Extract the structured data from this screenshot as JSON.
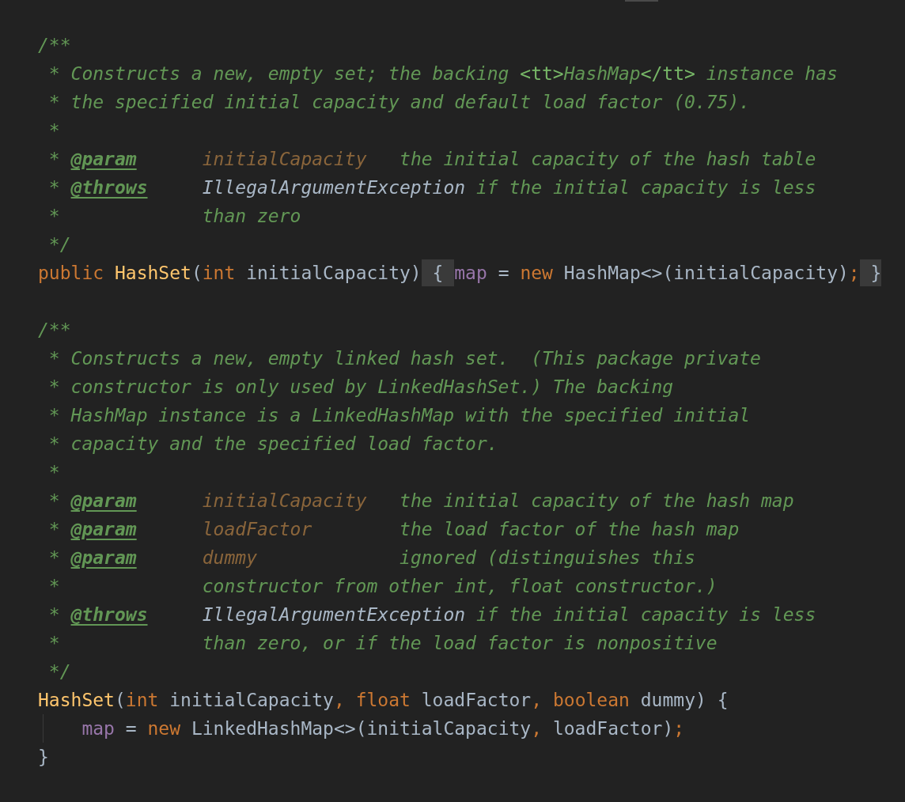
{
  "editor": {
    "lines": [
      {
        "kind": "code",
        "tokens": [
          {
            "kind": "comment",
            "text": "/**"
          }
        ]
      },
      {
        "kind": "code",
        "tokens": [
          {
            "kind": "comment",
            "text": " * Constructs a new, empty set; the backing "
          },
          {
            "kind": "html",
            "text": "<tt>"
          },
          {
            "kind": "comment",
            "text": "HashMap"
          },
          {
            "kind": "html",
            "text": "</tt>"
          },
          {
            "kind": "comment",
            "text": " instance has"
          }
        ]
      },
      {
        "kind": "code",
        "tokens": [
          {
            "kind": "comment",
            "text": " * the specified initial capacity and default load factor (0.75)."
          }
        ]
      },
      {
        "kind": "code",
        "tokens": [
          {
            "kind": "comment",
            "text": " *"
          }
        ]
      },
      {
        "kind": "code",
        "tokens": [
          {
            "kind": "comment",
            "text": " * "
          },
          {
            "kind": "doctag",
            "text": "@param"
          },
          {
            "kind": "param",
            "text": "      initialCapacity"
          },
          {
            "kind": "comment",
            "text": "   the initial capacity of the hash table"
          }
        ]
      },
      {
        "kind": "code",
        "tokens": [
          {
            "kind": "comment",
            "text": " * "
          },
          {
            "kind": "doctag",
            "text": "@throws"
          },
          {
            "kind": "ref",
            "text": "     IllegalArgumentException"
          },
          {
            "kind": "comment",
            "text": " if the initial capacity is less"
          }
        ]
      },
      {
        "kind": "code",
        "tokens": [
          {
            "kind": "comment",
            "text": " *"
          },
          {
            "kind": "comment",
            "text": "             than zero"
          }
        ]
      },
      {
        "kind": "code",
        "tokens": [
          {
            "kind": "comment",
            "text": " */"
          }
        ]
      },
      {
        "kind": "code",
        "tokens": [
          {
            "kind": "keyword",
            "text": "public "
          },
          {
            "kind": "method",
            "text": "HashSet"
          },
          {
            "kind": "ident",
            "text": "("
          },
          {
            "kind": "keyword",
            "text": "int"
          },
          {
            "kind": "ident",
            "text": " initialCapacity)"
          },
          {
            "kind": "fold",
            "text": " { "
          },
          {
            "kind": "field",
            "text": "map"
          },
          {
            "kind": "ident",
            "text": " = "
          },
          {
            "kind": "keyword",
            "text": "new"
          },
          {
            "kind": "ident",
            "text": " HashMap<>(initialCapacity)"
          },
          {
            "kind": "punct",
            "text": ";"
          },
          {
            "kind": "fold",
            "text": " }"
          }
        ]
      },
      {
        "kind": "blank"
      },
      {
        "kind": "code",
        "tokens": [
          {
            "kind": "comment",
            "text": "/**"
          }
        ]
      },
      {
        "kind": "code",
        "tokens": [
          {
            "kind": "comment",
            "text": " * Constructs a new, empty linked hash set.  (This package private"
          }
        ]
      },
      {
        "kind": "code",
        "tokens": [
          {
            "kind": "comment",
            "text": " * constructor is only used by LinkedHashSet.) The backing"
          }
        ]
      },
      {
        "kind": "code",
        "tokens": [
          {
            "kind": "comment",
            "text": " * HashMap instance is a LinkedHashMap with the specified initial"
          }
        ]
      },
      {
        "kind": "code",
        "tokens": [
          {
            "kind": "comment",
            "text": " * capacity and the specified load factor."
          }
        ]
      },
      {
        "kind": "code",
        "tokens": [
          {
            "kind": "comment",
            "text": " *"
          }
        ]
      },
      {
        "kind": "code",
        "tokens": [
          {
            "kind": "comment",
            "text": " * "
          },
          {
            "kind": "doctag",
            "text": "@param"
          },
          {
            "kind": "param",
            "text": "      initialCapacity"
          },
          {
            "kind": "comment",
            "text": "   the initial capacity of the hash map"
          }
        ]
      },
      {
        "kind": "code",
        "tokens": [
          {
            "kind": "comment",
            "text": " * "
          },
          {
            "kind": "doctag",
            "text": "@param"
          },
          {
            "kind": "param",
            "text": "      loadFactor"
          },
          {
            "kind": "comment",
            "text": "        the load factor of the hash map"
          }
        ]
      },
      {
        "kind": "code",
        "tokens": [
          {
            "kind": "comment",
            "text": " * "
          },
          {
            "kind": "doctag",
            "text": "@param"
          },
          {
            "kind": "param",
            "text": "      dummy"
          },
          {
            "kind": "comment",
            "text": "             ignored (distinguishes this"
          }
        ]
      },
      {
        "kind": "code",
        "tokens": [
          {
            "kind": "comment",
            "text": " *"
          },
          {
            "kind": "comment",
            "text": "             constructor from other int, float constructor.)"
          }
        ]
      },
      {
        "kind": "code",
        "tokens": [
          {
            "kind": "comment",
            "text": " * "
          },
          {
            "kind": "doctag",
            "text": "@throws"
          },
          {
            "kind": "ref",
            "text": "     IllegalArgumentException"
          },
          {
            "kind": "comment",
            "text": " if the initial capacity is less"
          }
        ]
      },
      {
        "kind": "code",
        "tokens": [
          {
            "kind": "comment",
            "text": " *"
          },
          {
            "kind": "comment",
            "text": "             than zero, or if the load factor is nonpositive"
          }
        ]
      },
      {
        "kind": "code",
        "tokens": [
          {
            "kind": "comment",
            "text": " */"
          }
        ]
      },
      {
        "kind": "code",
        "tokens": [
          {
            "kind": "method",
            "text": "HashSet"
          },
          {
            "kind": "ident",
            "text": "("
          },
          {
            "kind": "keyword",
            "text": "int"
          },
          {
            "kind": "ident",
            "text": " initialCapacity"
          },
          {
            "kind": "punct",
            "text": ","
          },
          {
            "kind": "keyword",
            "text": " float"
          },
          {
            "kind": "ident",
            "text": " loadFactor"
          },
          {
            "kind": "punct",
            "text": ","
          },
          {
            "kind": "keyword",
            "text": " boolean"
          },
          {
            "kind": "ident",
            "text": " dummy) {"
          }
        ]
      },
      {
        "kind": "guided",
        "tokens": [
          {
            "kind": "field",
            "text": "    map"
          },
          {
            "kind": "ident",
            "text": " = "
          },
          {
            "kind": "keyword",
            "text": "new"
          },
          {
            "kind": "ident",
            "text": " LinkedHashMap<>(initialCapacity"
          },
          {
            "kind": "punct",
            "text": ","
          },
          {
            "kind": "ident",
            "text": " loadFactor)"
          },
          {
            "kind": "punct",
            "text": ";"
          }
        ]
      },
      {
        "kind": "code",
        "tokens": [
          {
            "kind": "ident",
            "text": "}"
          }
        ]
      }
    ]
  }
}
